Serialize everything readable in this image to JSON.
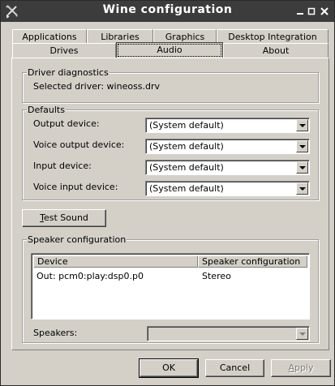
{
  "window": {
    "title": "Wine configuration"
  },
  "tabs": {
    "row1": [
      {
        "label": "Applications"
      },
      {
        "label": "Libraries"
      },
      {
        "label": "Graphics"
      },
      {
        "label": "Desktop Integration"
      }
    ],
    "row2": [
      {
        "label": "Drives"
      },
      {
        "label": "Audio",
        "active": true
      },
      {
        "label": "About"
      }
    ]
  },
  "driver_diagnostics": {
    "title": "Driver diagnostics",
    "selected_driver": "Selected driver: wineoss.drv"
  },
  "defaults": {
    "title": "Defaults",
    "rows": [
      {
        "label": "Output device:",
        "value": "(System default)"
      },
      {
        "label": "Voice output device:",
        "value": "(System default)"
      },
      {
        "label": "Input device:",
        "value": "(System default)"
      },
      {
        "label": "Voice input device:",
        "value": "(System default)"
      }
    ]
  },
  "test_sound": {
    "label_mnemonic": "T",
    "label_rest": "est Sound"
  },
  "speaker_config": {
    "title": "Speaker configuration",
    "columns": [
      "Device",
      "Speaker configuration"
    ],
    "rows": [
      {
        "device": "Out: pcm0:play:dsp0.p0",
        "config": "Stereo"
      }
    ],
    "speakers_label": "Speakers:",
    "speakers_value": ""
  },
  "footer": {
    "ok": "OK",
    "cancel": "Cancel",
    "apply_mnemonic": "A",
    "apply_rest": "pply"
  }
}
